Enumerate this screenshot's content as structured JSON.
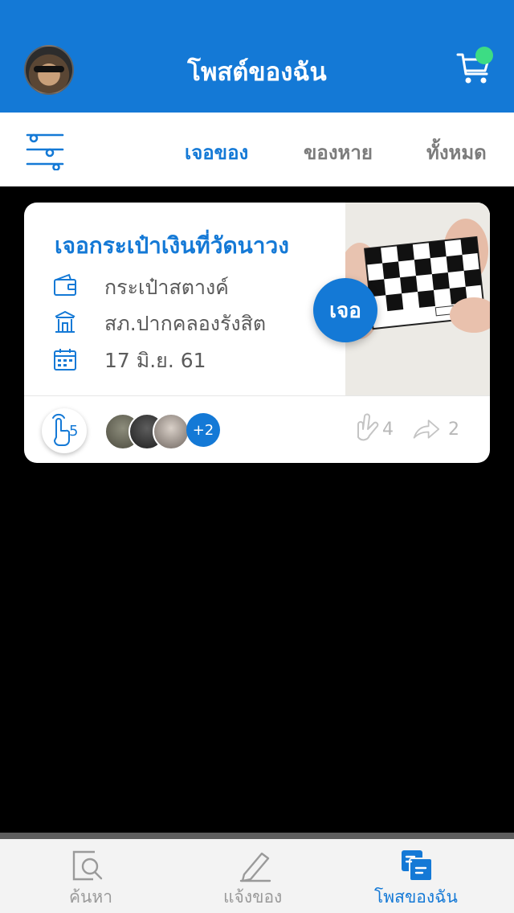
{
  "header": {
    "title": "โพสต์ของฉัน",
    "bg_color": "#1479d6",
    "notification_dot_color": "#3ddc84"
  },
  "tabs": [
    {
      "label": "เจอของ",
      "active": true
    },
    {
      "label": "ของหาย",
      "active": false
    },
    {
      "label": "ทั้งหมด",
      "active": false
    }
  ],
  "post": {
    "title": "เจอกระเป๋าเงินที่วัดนาวง",
    "item": "กระเป๋าสตางค์",
    "location": "สภ.ปากคลองรังสิต",
    "date": "17 มิ.ย. 61",
    "status_badge": "เจอ",
    "tap_count": "5",
    "more_people": "+2",
    "likes": "4",
    "shares": "2"
  },
  "bottom_nav": [
    {
      "label": "ค้นหา",
      "icon": "search-icon",
      "active": false
    },
    {
      "label": "แจ้งของ",
      "icon": "pen-icon",
      "active": false
    },
    {
      "label": "โพสของฉัน",
      "icon": "my-posts-icon",
      "active": true
    }
  ],
  "accent_color": "#1479d6"
}
